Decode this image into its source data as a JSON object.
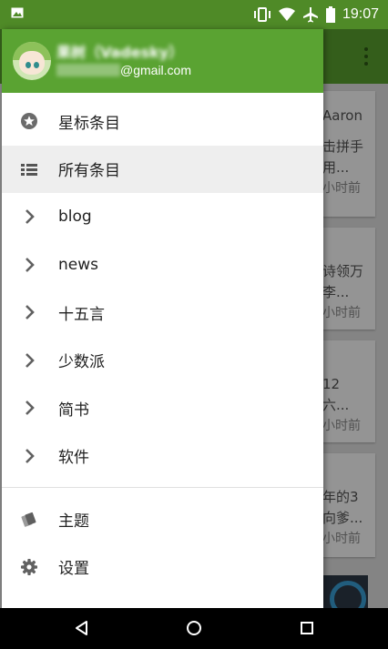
{
  "status_bar": {
    "time": "19:07",
    "left_icon": "image-notification-icon",
    "right_icons": [
      "vibrate-icon",
      "wifi-icon",
      "airplane-icon",
      "battery-icon"
    ]
  },
  "toolbar": {
    "color": "#5aa32f",
    "overflow_icon": "more-vert-icon"
  },
  "drawer": {
    "header": {
      "color": "#5aa332",
      "user_name": "果树（Vadesky）",
      "email_domain": "@gmail.com"
    },
    "items": [
      {
        "label": "星标条目",
        "icon": "star-circle-icon",
        "selected": false
      },
      {
        "label": "所有条目",
        "icon": "list-icon",
        "selected": true
      },
      {
        "label": "blog",
        "icon": "chevron-right-icon",
        "selected": false
      },
      {
        "label": "news",
        "icon": "chevron-right-icon",
        "selected": false
      },
      {
        "label": "十五言",
        "icon": "chevron-right-icon",
        "selected": false
      },
      {
        "label": "少数派",
        "icon": "chevron-right-icon",
        "selected": false
      },
      {
        "label": "简书",
        "icon": "chevron-right-icon",
        "selected": false
      },
      {
        "label": "软件",
        "icon": "chevron-right-icon",
        "selected": false
      }
    ],
    "footer_items": [
      {
        "label": "主题",
        "icon": "theme-icon"
      },
      {
        "label": "设置",
        "icon": "gear-icon"
      }
    ]
  },
  "background_cards": [
    {
      "lines": [
        "Aaron",
        "击拼手",
        "用..."
      ],
      "time": "小时前"
    },
    {
      "lines": [
        "诗领万",
        "李..."
      ],
      "time": "小时前"
    },
    {
      "lines": [
        "12",
        "六..."
      ],
      "time": "小时前"
    },
    {
      "lines": [
        "年的3",
        "向爹..."
      ],
      "time": "小时前"
    }
  ],
  "nav_bar": {
    "buttons": [
      "back-icon",
      "home-icon",
      "recents-icon"
    ]
  }
}
